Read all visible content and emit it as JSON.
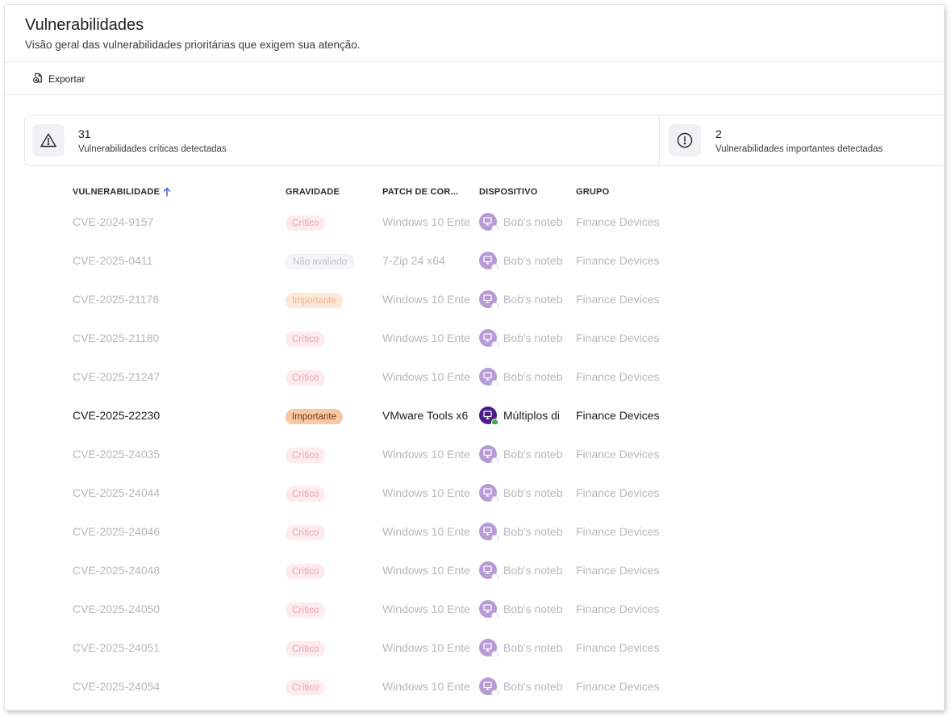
{
  "header": {
    "title": "Vulnerabilidades",
    "subtitle": "Visão geral das vulnerabilidades prioritárias que exigem sua atenção."
  },
  "toolbar": {
    "export_label": "Exportar",
    "export_icon": "export-icon"
  },
  "summary": {
    "critical": {
      "count": "31",
      "label": "Vulnerabilidades críticas detectadas",
      "icon": "warning-triangle-icon"
    },
    "important": {
      "count": "2",
      "label": "Vulnerabilidades importantes detectadas",
      "icon": "exclamation-circle-icon"
    }
  },
  "table": {
    "columns": {
      "vulnerability": "VULNERABILIDADE",
      "severity": "GRAVIDADE",
      "patch": "PATCH DE COR...",
      "device": "DISPOSITIVO",
      "group": "GRUPO"
    },
    "sort": {
      "column": "vulnerability",
      "direction": "asc",
      "icon": "arrow-up-icon"
    },
    "rows": [
      {
        "cve": "CVE-2024-9157",
        "severity": "Crítico",
        "severity_kind": "critico",
        "patch": "Windows 10 Ente",
        "device": "Bob's noteb",
        "group": "Finance Devices",
        "active": false
      },
      {
        "cve": "CVE-2025-0411",
        "severity": "Não avaliado",
        "severity_kind": "nao",
        "patch": "7-Zip 24 x64",
        "device": "Bob's noteb",
        "group": "Finance Devices",
        "active": false
      },
      {
        "cve": "CVE-2025-21176",
        "severity": "Importante",
        "severity_kind": "importante",
        "patch": "Windows 10 Ente",
        "device": "Bob's noteb",
        "group": "Finance Devices",
        "active": false
      },
      {
        "cve": "CVE-2025-21180",
        "severity": "Crítico",
        "severity_kind": "critico",
        "patch": "Windows 10 Ente",
        "device": "Bob's noteb",
        "group": "Finance Devices",
        "active": false
      },
      {
        "cve": "CVE-2025-21247",
        "severity": "Crítico",
        "severity_kind": "critico",
        "patch": "Windows 10 Ente",
        "device": "Bob's noteb",
        "group": "Finance Devices",
        "active": false
      },
      {
        "cve": "CVE-2025-22230",
        "severity": "Importante",
        "severity_kind": "importante",
        "patch": "VMware Tools x6",
        "device": "Múltiplos di",
        "group": "Finance Devices",
        "active": true
      },
      {
        "cve": "CVE-2025-24035",
        "severity": "Crítico",
        "severity_kind": "critico",
        "patch": "Windows 10 Ente",
        "device": "Bob's noteb",
        "group": "Finance Devices",
        "active": false
      },
      {
        "cve": "CVE-2025-24044",
        "severity": "Crítico",
        "severity_kind": "critico",
        "patch": "Windows 10 Ente",
        "device": "Bob's noteb",
        "group": "Finance Devices",
        "active": false
      },
      {
        "cve": "CVE-2025-24046",
        "severity": "Crítico",
        "severity_kind": "critico",
        "patch": "Windows 10 Ente",
        "device": "Bob's noteb",
        "group": "Finance Devices",
        "active": false
      },
      {
        "cve": "CVE-2025-24048",
        "severity": "Crítico",
        "severity_kind": "critico",
        "patch": "Windows 10 Ente",
        "device": "Bob's noteb",
        "group": "Finance Devices",
        "active": false
      },
      {
        "cve": "CVE-2025-24050",
        "severity": "Crítico",
        "severity_kind": "critico",
        "patch": "Windows 10 Ente",
        "device": "Bob's noteb",
        "group": "Finance Devices",
        "active": false
      },
      {
        "cve": "CVE-2025-24051",
        "severity": "Crítico",
        "severity_kind": "critico",
        "patch": "Windows 10 Ente",
        "device": "Bob's noteb",
        "group": "Finance Devices",
        "active": false
      },
      {
        "cve": "CVE-2025-24054",
        "severity": "Crítico",
        "severity_kind": "critico",
        "patch": "Windows 10 Ente",
        "device": "Bob's noteb",
        "group": "Finance Devices",
        "active": false
      }
    ]
  },
  "colors": {
    "accent": "#4a1d86",
    "sort_arrow": "#3b5bdb",
    "online": "#3cb043"
  }
}
